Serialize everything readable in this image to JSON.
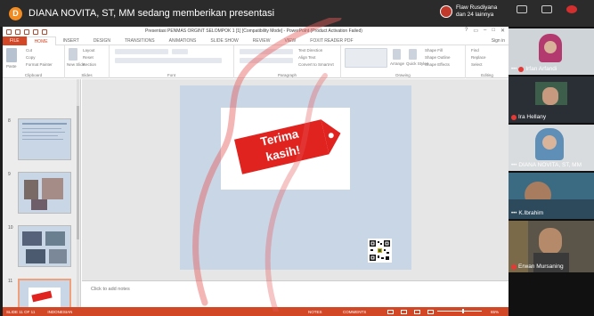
{
  "meeting": {
    "presenter_initial": "D",
    "presenter_banner": "DIANA NOVITA, ST, MM sedang memberikan presentasi",
    "notification": {
      "line1": "Flaw Rusdiyana",
      "line2": "dan 24 lainnya"
    },
    "icons": [
      {
        "name": "participants-icon",
        "label": ""
      },
      {
        "name": "chat-icon",
        "label": ""
      },
      {
        "name": "user-avatar-icon",
        "label": ""
      }
    ]
  },
  "app": {
    "document_title": "Presentasi PENMAS ORGINT SELOMPOK 1 [1] [Compatibility Mode] - PowerPoint (Product Activation Failed)",
    "window_controls": [
      "?",
      "▭",
      "–",
      "□",
      "✕"
    ],
    "tabs": [
      "FILE",
      "HOME",
      "INSERT",
      "DESIGN",
      "TRANSITIONS",
      "ANIMATIONS",
      "SLIDE SHOW",
      "REVIEW",
      "VIEW",
      "FOXIT READER PDF"
    ],
    "active_tab": "HOME",
    "sign_in": "Sign in",
    "ribbon_groups": [
      "Clipboard",
      "Slides",
      "Font",
      "Paragraph",
      "Drawing",
      "Editing"
    ],
    "ribbon_items": {
      "paste": "Paste",
      "cut": "Cut",
      "copy": "Copy",
      "format_painter": "Format Painter",
      "new_slide": "New Slide",
      "layout": "Layout",
      "reset": "Reset",
      "section": "Section",
      "text_direction": "Text Direction",
      "align_text": "Align Text",
      "convert_smartart": "Convert to SmartArt",
      "arrange": "Arrange",
      "quick_styles": "Quick Styles",
      "shape_fill": "Shape Fill",
      "shape_outline": "Shape Outline",
      "shape_effects": "Shape Effects",
      "find": "Find",
      "replace": "Replace",
      "select": "Select"
    }
  },
  "slides_pane": {
    "items": [
      {
        "number": "8"
      },
      {
        "number": "9"
      },
      {
        "number": "10"
      },
      {
        "number": "11"
      }
    ],
    "selected": "11"
  },
  "slide": {
    "tag_line1": "Terima",
    "tag_line2": "kasih!",
    "accent": "#e0231f",
    "background": "#c9d6e6"
  },
  "notes_placeholder": "Click to add notes",
  "status_bar": {
    "slide_info": "SLIDE 11 OF 11",
    "language": "INDONESIAN",
    "notes": "NOTES",
    "comments": "COMMENTS",
    "zoom": "65%"
  },
  "participants": [
    {
      "name": "Irfan Arfandi",
      "muted": true
    },
    {
      "name": "Ira Hellany",
      "muted": true
    },
    {
      "name": "DIANA NOVITA, ST, MM",
      "muted": false
    },
    {
      "name": "K.Ibrahim",
      "muted": false
    },
    {
      "name": "Erwan Mursaning",
      "muted": true
    }
  ]
}
